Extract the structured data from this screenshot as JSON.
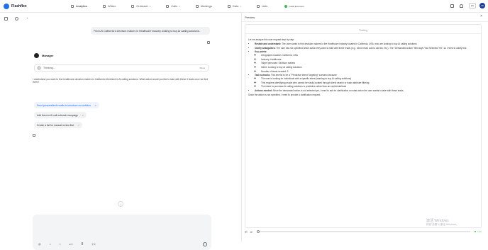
{
  "app": {
    "name": "Flashflex"
  },
  "nav": {
    "items": [
      {
        "label": "Analytics",
        "icon": "chart-icon",
        "has_caret": false
      },
      {
        "label": "Writex",
        "icon": "pen-icon",
        "has_caret": false
      },
      {
        "label": "Outreach",
        "icon": "send-icon",
        "has_caret": true
      },
      {
        "label": "Calls",
        "icon": "phone-icon",
        "has_caret": true
      },
      {
        "label": "Meetings",
        "icon": "calendar-icon",
        "has_caret": false
      },
      {
        "label": "Data",
        "icon": "database-icon",
        "has_caret": true
      },
      {
        "label": "Lists",
        "icon": "list-icon",
        "has_caret": false
      }
    ],
    "install_label": "Install Extension"
  },
  "header_right": {
    "lang": "EN",
    "avatar_initials": "AD"
  },
  "chat": {
    "user_message": "Find US California's Decision makers in Healthcare industry looking to buy AI calling solutions.",
    "agent_name": "Manager",
    "thinking_label": "Thinking...",
    "thinking_toggle": "Show",
    "answer": "I understand you want to find healthcare decision makers in California interested in AI calling solutions. What action would you like to take with these 3 leads once we find them?",
    "suggestions": [
      {
        "label": "Send personalized emails to introduce our solution"
      },
      {
        "label": "Add them to AI call outreach campaign"
      },
      {
        "label": "Create a list for manual review first"
      }
    ],
    "composer_tools": [
      "@",
      "⌗",
      "≡",
      "⌀ ▾",
      "≣",
      "⚲ ▾"
    ]
  },
  "preview": {
    "title": "Preview",
    "thinking_tag": "Thinking",
    "intro": "Let me analyze this user request step by step:",
    "items": [
      {
        "label": "Restate and understand:",
        "text": " The user wants to find decision makers in the Healthcare industry located in California, USA, who are looking to buy AI calling solutions."
      },
      {
        "label": "Clarify ambiguities:",
        "text": " The user has not specified which action they want to take with these leads (e.g., send email, add to call list, etc.). The \"Demanded Action\" field says \"Not Selected Yet\", so I need to clarify this."
      },
      {
        "label": "Key points:",
        "text": ""
      },
      {
        "label": "Task scenario:",
        "text": " This seems to be a \"Predictive Intent Targeting\" scenario because:"
      },
      {
        "label": "Actions needed:",
        "text": " Since the demanded action is not selected yet, I need to ask for clarification on what action the user wants to take with these leads."
      }
    ],
    "key_points": [
      "Geographic location: California, USA",
      "Industry: Healthcare",
      "Target personas: Decision makers",
      "Intent: Looking to buy AI calling solutions",
      "Number of leads needed: 3"
    ],
    "scenario_points": [
      "The user is looking for individuals with a specific intent (wanting to buy AI calling solutions)",
      "This requires identifying people who cannot be easily located through direct search or basic attribute filtering",
      "The intent to purchase AI calling solutions is predictive rather than an explicit attribute"
    ],
    "closing": "Since the action is not specified, I need to provide a clarification request.",
    "live_label": "Live",
    "progress": 0.0
  },
  "watermark": {
    "line1": "激活 Windows",
    "line2": "转到\"设置\"以激活 Windows。"
  }
}
